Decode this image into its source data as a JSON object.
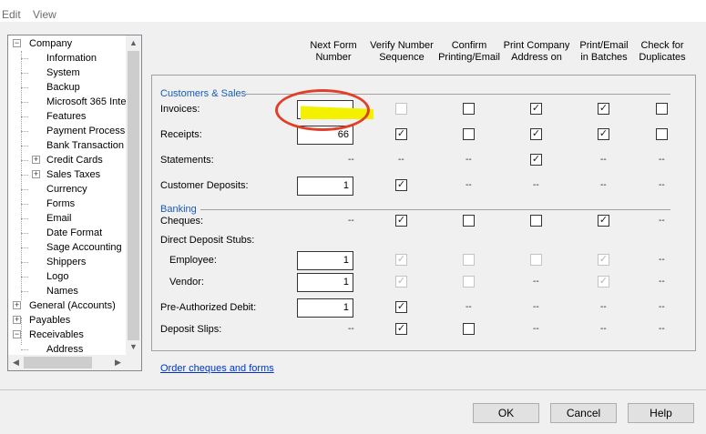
{
  "menu": {
    "edit": "Edit",
    "view": "View"
  },
  "tree": {
    "items": [
      {
        "label": "Company",
        "level": 0,
        "expander": "−"
      },
      {
        "label": "Information",
        "level": 1
      },
      {
        "label": "System",
        "level": 1
      },
      {
        "label": "Backup",
        "level": 1
      },
      {
        "label": "Microsoft 365 Inte",
        "level": 1
      },
      {
        "label": "Features",
        "level": 1
      },
      {
        "label": "Payment Processi",
        "level": 1
      },
      {
        "label": "Bank Transaction",
        "level": 1
      },
      {
        "label": "Credit Cards",
        "level": 1,
        "expander": "+"
      },
      {
        "label": "Sales Taxes",
        "level": 1,
        "expander": "+"
      },
      {
        "label": "Currency",
        "level": 1
      },
      {
        "label": "Forms",
        "level": 1
      },
      {
        "label": "Email",
        "level": 1
      },
      {
        "label": "Date Format",
        "level": 1
      },
      {
        "label": "Sage Accounting",
        "level": 1
      },
      {
        "label": "Shippers",
        "level": 1
      },
      {
        "label": "Logo",
        "level": 1
      },
      {
        "label": "Names",
        "level": 1
      },
      {
        "label": "General (Accounts)",
        "level": 0,
        "expander": "+"
      },
      {
        "label": "Payables",
        "level": 0,
        "expander": "+"
      },
      {
        "label": "Receivables",
        "level": 0,
        "expander": "−"
      },
      {
        "label": "Address",
        "level": 1
      }
    ]
  },
  "columns": [
    {
      "line1": "Next Form",
      "line2": "Number"
    },
    {
      "line1": "Verify Number",
      "line2": "Sequence"
    },
    {
      "line1": "Confirm",
      "line2": "Printing/Email"
    },
    {
      "line1": "Print Company",
      "line2": "Address on"
    },
    {
      "line1": "Print/Email",
      "line2": "in Batches"
    },
    {
      "line1": "Check for",
      "line2": "Duplicates"
    }
  ],
  "sections": {
    "sales": "Customers & Sales",
    "banking": "Banking"
  },
  "rows": {
    "invoices": {
      "label": "Invoices:",
      "value": "",
      "cells": [
        "dis",
        "off",
        "on",
        "on",
        "off"
      ]
    },
    "receipts": {
      "label": "Receipts:",
      "value": "66",
      "cells": [
        "on",
        "off",
        "on",
        "on",
        "off"
      ]
    },
    "statements": {
      "label": "Statements:",
      "value": "--",
      "cells": [
        "--",
        "--",
        "on",
        "--",
        "--"
      ]
    },
    "customer_deposits": {
      "label": "Customer Deposits:",
      "value": "1",
      "cells": [
        "on",
        "--",
        "--",
        "--",
        "--"
      ]
    },
    "cheques": {
      "label": "Cheques:",
      "value": "--",
      "cells": [
        "on",
        "off",
        "off",
        "on",
        "--"
      ]
    },
    "direct_deposit": {
      "label": "Direct Deposit Stubs:"
    },
    "employee": {
      "label": "Employee:",
      "value": "1",
      "cells": [
        "dison",
        "dis",
        "dis",
        "dison",
        "--"
      ]
    },
    "vendor": {
      "label": "Vendor:",
      "value": "1",
      "cells": [
        "dison",
        "dis",
        "--",
        "dison",
        "--"
      ]
    },
    "preauth": {
      "label": "Pre-Authorized Debit:",
      "value": "1",
      "cells": [
        "on",
        "--",
        "--",
        "--",
        "--"
      ]
    },
    "deposit_slips": {
      "label": "Deposit Slips:",
      "value": "--",
      "cells": [
        "on",
        "off",
        "--",
        "--",
        "--"
      ]
    }
  },
  "link": "Order cheques and forms",
  "buttons": {
    "ok": "OK",
    "cancel": "Cancel",
    "help": "Help"
  },
  "colors": {
    "highlight": "#f3f000",
    "annotation": "#e0402a",
    "link": "#0033cc",
    "section": "#1a5bb5"
  }
}
